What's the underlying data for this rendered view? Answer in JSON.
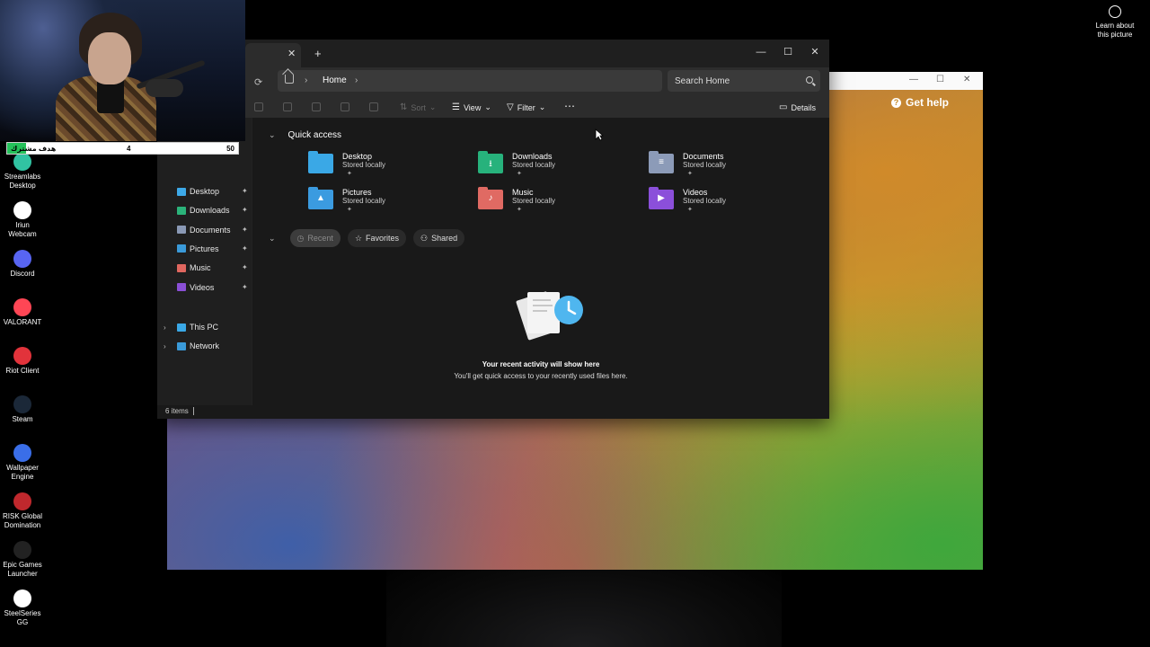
{
  "desktop": {
    "icons": [
      {
        "label_1": "Streamlabs",
        "label_2": "Desktop",
        "icon": "streamlabs-icon",
        "color": "#31c3a2"
      },
      {
        "label_1": "Iriun",
        "label_2": "Webcam",
        "icon": "iriun-webcam-icon",
        "color": "#ffffff"
      },
      {
        "label_1": "Discord",
        "label_2": "",
        "icon": "discord-icon",
        "color": "#5865f2"
      },
      {
        "label_1": "VALORANT",
        "label_2": "",
        "icon": "valorant-icon",
        "color": "#ff4655"
      },
      {
        "label_1": "Riot Client",
        "label_2": "",
        "icon": "riot-client-icon",
        "color": "#e2333b"
      },
      {
        "label_1": "Steam",
        "label_2": "",
        "icon": "steam-icon",
        "color": "#1b2838"
      },
      {
        "label_1": "Wallpaper",
        "label_2": "Engine",
        "icon": "wallpaper-engine-icon",
        "color": "#3a6ee8"
      },
      {
        "label_1": "RISK Global",
        "label_2": "Domination",
        "icon": "risk-icon",
        "color": "#c0282d"
      },
      {
        "label_1": "Epic Games",
        "label_2": "Launcher",
        "icon": "epic-games-icon",
        "color": "#222222"
      },
      {
        "label_1": "SteelSeries",
        "label_2": "GG",
        "icon": "steelseries-icon",
        "color": "#ffffff"
      }
    ],
    "learn_line_1": "Learn about",
    "learn_line_2": "this picture"
  },
  "overlay": {
    "goal_label": "هدف مشترك",
    "goal_current": "4",
    "goal_max": "50",
    "goal_fraction": 0.08
  },
  "help_window": {
    "get_help": "Get help"
  },
  "explorer": {
    "breadcrumb": "Home",
    "search_placeholder": "Search Home",
    "commands": {
      "sort": "Sort",
      "view": "View",
      "filter": "Filter",
      "details": "Details"
    },
    "sidebar": {
      "pinned": [
        {
          "label": "Desktop",
          "icon": "desktop-folder-icon",
          "color": "#3da9e8"
        },
        {
          "label": "Downloads",
          "icon": "downloads-folder-icon",
          "color": "#2bb37a"
        },
        {
          "label": "Documents",
          "icon": "documents-folder-icon",
          "color": "#8a99b5"
        },
        {
          "label": "Pictures",
          "icon": "pictures-folder-icon",
          "color": "#3a9ad9"
        },
        {
          "label": "Music",
          "icon": "music-folder-icon",
          "color": "#e0675f"
        },
        {
          "label": "Videos",
          "icon": "videos-folder-icon",
          "color": "#8a4fd6"
        }
      ],
      "this_pc": "This PC",
      "network": "Network"
    },
    "quick_access_title": "Quick access",
    "quick_access": [
      {
        "name": "Desktop",
        "sub": "Stored locally",
        "color": "#3aa8e6",
        "icon": "desktop-folder-icon"
      },
      {
        "name": "Downloads",
        "sub": "Stored locally",
        "color": "#27b27c",
        "icon": "downloads-folder-icon"
      },
      {
        "name": "Documents",
        "sub": "Stored locally",
        "color": "#8c9bb8",
        "icon": "documents-folder-icon"
      },
      {
        "name": "Pictures",
        "sub": "Stored locally",
        "color": "#3b9be0",
        "icon": "pictures-folder-icon"
      },
      {
        "name": "Music",
        "sub": "Stored locally",
        "color": "#e06a63",
        "icon": "music-folder-icon"
      },
      {
        "name": "Videos",
        "sub": "Stored locally",
        "color": "#8b4fda",
        "icon": "videos-folder-icon"
      }
    ],
    "filters": {
      "recent": "Recent",
      "favorites": "Favorites",
      "shared": "Shared"
    },
    "empty_title": "Your recent activity will show here",
    "empty_subtitle": "You'll get quick access to your recently used files here.",
    "status": "6 items"
  }
}
